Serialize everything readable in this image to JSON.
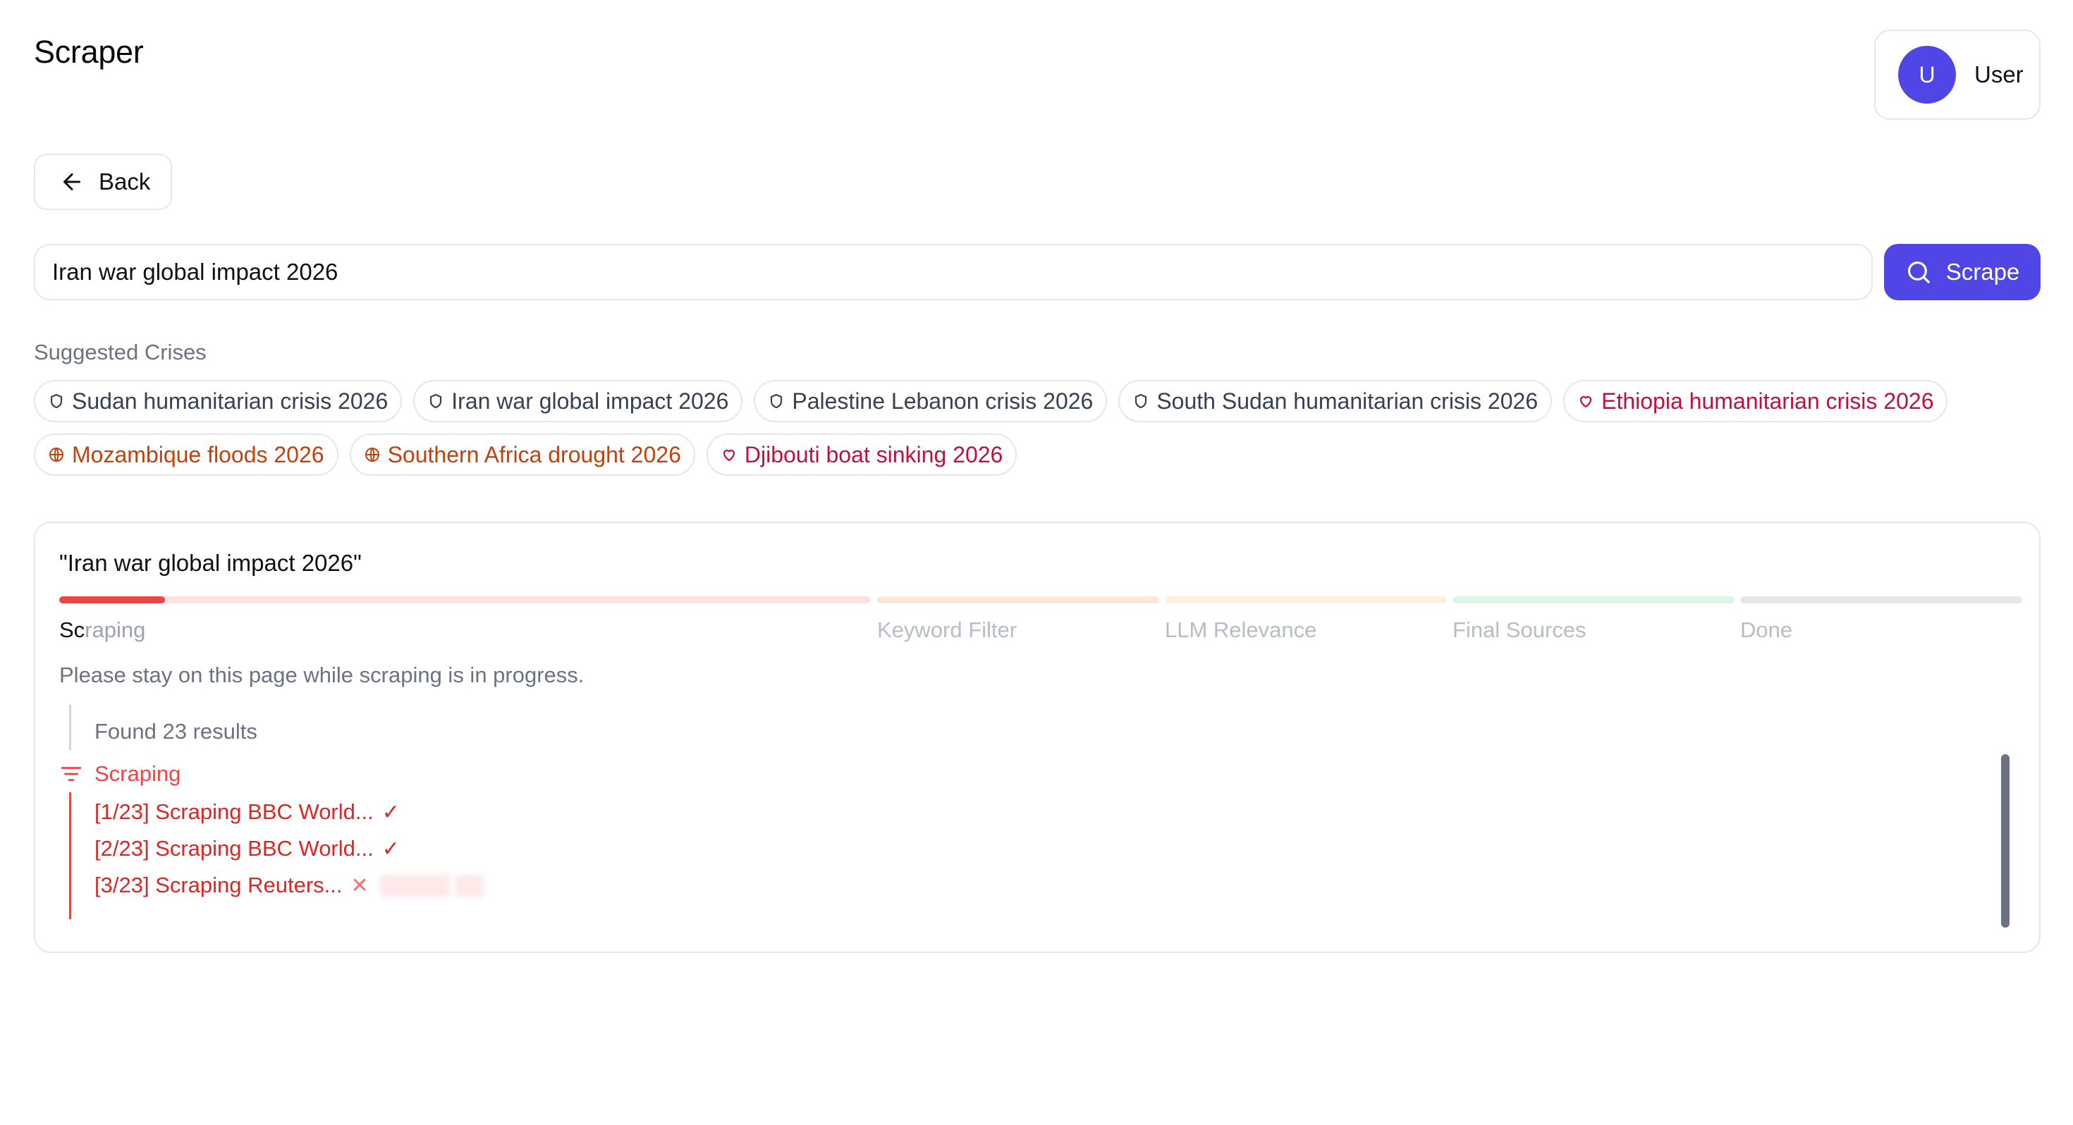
{
  "header": {
    "title": "Scraper"
  },
  "user": {
    "initial": "U",
    "name": "User"
  },
  "nav": {
    "back_label": "Back"
  },
  "search": {
    "value": "Iran war global impact 2026",
    "button_label": "Scrape"
  },
  "suggested": {
    "title": "Suggested Crises",
    "chips": [
      {
        "label": "Sudan humanitarian crisis 2026",
        "icon": "shield-icon",
        "color": "#374151"
      },
      {
        "label": "Iran war global impact 2026",
        "icon": "shield-icon",
        "color": "#374151"
      },
      {
        "label": "Palestine Lebanon crisis 2026",
        "icon": "shield-icon",
        "color": "#374151"
      },
      {
        "label": "South Sudan humanitarian crisis 2026",
        "icon": "shield-icon",
        "color": "#374151"
      },
      {
        "label": "Ethiopia humanitarian crisis 2026",
        "icon": "heart-icon",
        "color": "#be123c"
      },
      {
        "label": "Mozambique floods 2026",
        "icon": "globe-icon",
        "color": "#c2410c"
      },
      {
        "label": "Southern Africa drought 2026",
        "icon": "globe-icon",
        "color": "#c2410c"
      },
      {
        "label": "Djibouti boat sinking 2026",
        "icon": "heart-icon",
        "color": "#be123c"
      }
    ]
  },
  "progress": {
    "query_title": "\"Iran war global impact 2026\"",
    "stages": [
      {
        "label": "Scraping",
        "color": "#ef4444",
        "track": "#fde0e0",
        "active": true,
        "fill": 0.13
      },
      {
        "label": "Keyword Filter",
        "color": "#f97316",
        "track": "#fde7da",
        "active": false,
        "fill": 0
      },
      {
        "label": "LLM Relevance",
        "color": "#f59e0b",
        "track": "#fdf0dc",
        "active": false,
        "fill": 0
      },
      {
        "label": "Final Sources",
        "color": "#22c55e",
        "track": "#dcf5e4",
        "active": false,
        "fill": 0
      },
      {
        "label": "Done",
        "color": "#9ca3af",
        "track": "#e5e7eb",
        "active": false,
        "fill": 0
      }
    ],
    "stay_message": "Please stay on this page while scraping is in progress.",
    "log": {
      "found_text": "Found 23 results",
      "section_label": "Scraping",
      "entries": [
        {
          "text": "[1/23] Scraping BBC World...",
          "status": "✓"
        },
        {
          "text": "[2/23] Scraping BBC World...",
          "status": "✓"
        },
        {
          "text": "[3/23] Scraping Reuters...",
          "status": "✕"
        }
      ]
    }
  }
}
